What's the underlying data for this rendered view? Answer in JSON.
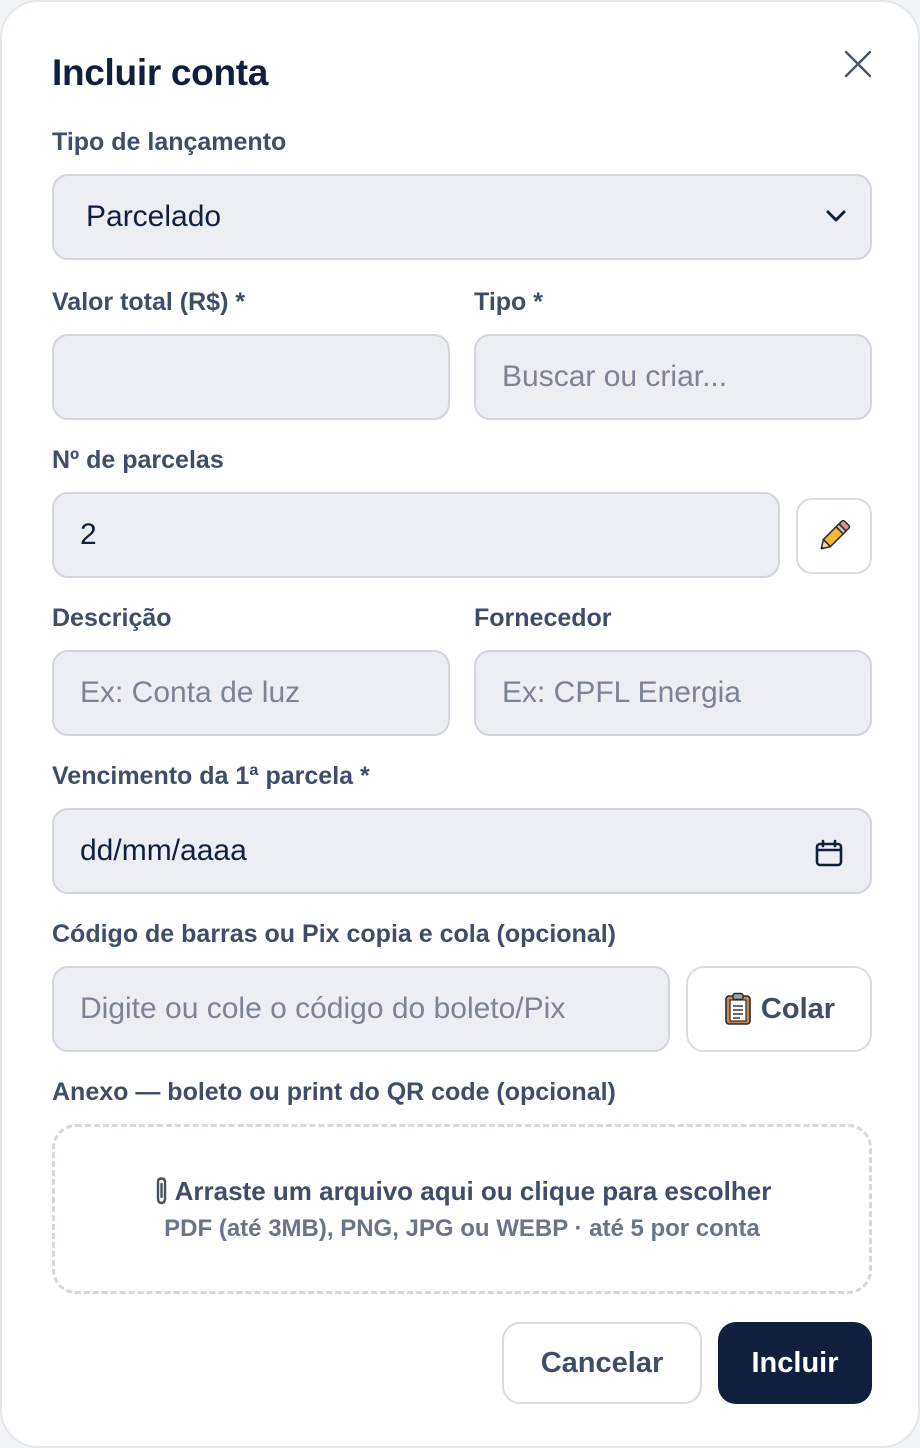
{
  "modal": {
    "title": "Incluir conta"
  },
  "fields": {
    "tipo_lancamento": {
      "label": "Tipo de lançamento",
      "value": "Parcelado"
    },
    "valor_total": {
      "label": "Valor total (R$) *",
      "value": ""
    },
    "tipo": {
      "label": "Tipo *",
      "placeholder": "Buscar ou criar..."
    },
    "parcelas": {
      "label": "Nº de parcelas",
      "value": "2"
    },
    "descricao": {
      "label": "Descrição",
      "placeholder": "Ex: Conta de luz"
    },
    "fornecedor": {
      "label": "Fornecedor",
      "placeholder": "Ex: CPFL Energia"
    },
    "vencimento": {
      "label": "Vencimento da 1ª parcela *",
      "value": "dd/mm/aaaa"
    },
    "codigo": {
      "label": "Código de barras ou Pix copia e cola (opcional)",
      "placeholder": "Digite ou cole o código do boleto/Pix"
    }
  },
  "paste_button": {
    "label": "Colar",
    "icon": "clipboard-icon"
  },
  "attachment": {
    "label": "Anexo — boleto ou print do QR code (opcional)",
    "main": "Arraste um arquivo aqui ou clique para escolher",
    "sub": "PDF (até 3MB), PNG, JPG ou WEBP · até 5 por conta",
    "icon": "paperclip-icon"
  },
  "actions": {
    "cancel": "Cancelar",
    "submit": "Incluir"
  },
  "colors": {
    "primary": "#0f1f3d",
    "label": "#3f4d6b",
    "field_bg": "#eceef3",
    "field_border": "#d0d5de"
  }
}
